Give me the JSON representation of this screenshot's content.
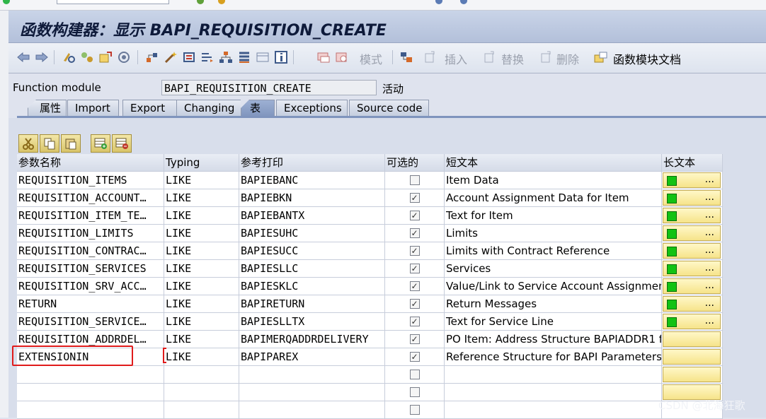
{
  "window": {
    "title": "函数构建器：显示 BAPI_REQUISITION_CREATE"
  },
  "toolbar": {
    "mode_label": "模式",
    "insert_label": "插入",
    "replace_label": "替换",
    "delete_label": "删除",
    "docs_label": "函数模块文档"
  },
  "header": {
    "function_module_label": "Function module",
    "function_module_value": "BAPI_REQUISITION_CREATE",
    "status": "活动"
  },
  "tabs": [
    {
      "label": "属性"
    },
    {
      "label": "Import"
    },
    {
      "label": "Export"
    },
    {
      "label": "Changing"
    },
    {
      "label": "表"
    },
    {
      "label": "Exceptions"
    },
    {
      "label": "Source code"
    }
  ],
  "active_tab": "表",
  "table": {
    "columns": [
      "参数名称",
      "Typing",
      "参考打印",
      "可选的",
      "短文本",
      "长文本"
    ],
    "rows": [
      {
        "name": "REQUISITION_ITEMS",
        "typing": "LIKE",
        "ref": "BAPIEBANC",
        "optional": false,
        "short_text": "Item Data",
        "long_text": true
      },
      {
        "name": "REQUISITION_ACCOUNT…",
        "typing": "LIKE",
        "ref": "BAPIEBKN",
        "optional": true,
        "short_text": "Account Assignment Data for Item",
        "long_text": true
      },
      {
        "name": "REQUISITION_ITEM_TE…",
        "typing": "LIKE",
        "ref": "BAPIEBANTX",
        "optional": true,
        "short_text": "Text for Item",
        "long_text": true
      },
      {
        "name": "REQUISITION_LIMITS",
        "typing": "LIKE",
        "ref": "BAPIESUHC",
        "optional": true,
        "short_text": "Limits",
        "long_text": true
      },
      {
        "name": "REQUISITION_CONTRAC…",
        "typing": "LIKE",
        "ref": "BAPIESUCC",
        "optional": true,
        "short_text": "Limits with Contract Reference",
        "long_text": true
      },
      {
        "name": "REQUISITION_SERVICES",
        "typing": "LIKE",
        "ref": "BAPIESLLC",
        "optional": true,
        "short_text": "Services",
        "long_text": true
      },
      {
        "name": "REQUISITION_SRV_ACC…",
        "typing": "LIKE",
        "ref": "BAPIESKLC",
        "optional": true,
        "short_text": "Value/Link to Service Account Assignment",
        "long_text": true
      },
      {
        "name": "RETURN",
        "typing": "LIKE",
        "ref": "BAPIRETURN",
        "optional": true,
        "short_text": "Return Messages",
        "long_text": true
      },
      {
        "name": "REQUISITION_SERVICE…",
        "typing": "LIKE",
        "ref": "BAPIESLLTX",
        "optional": true,
        "short_text": "Text for Service Line",
        "long_text": true
      },
      {
        "name": "REQUISITION_ADDRDEL…",
        "typing": "LIKE",
        "ref": "BAPIMERQADDRDELIVERY",
        "optional": true,
        "short_text": "PO Item: Address Structure BAPIADDR1 f…",
        "long_text": false
      },
      {
        "name": "EXTENSIONIN",
        "typing": "LIKE",
        "ref": "BAPIPAREX",
        "optional": true,
        "short_text": "Reference Structure for BAPI Parameters …",
        "long_text": false
      },
      {
        "name": "",
        "typing": "",
        "ref": "",
        "optional": false,
        "short_text": "",
        "long_text": false,
        "empty": true
      },
      {
        "name": "",
        "typing": "",
        "ref": "",
        "optional": false,
        "short_text": "",
        "long_text": false,
        "empty": true
      },
      {
        "name": "",
        "typing": "",
        "ref": "",
        "optional": false,
        "short_text": "",
        "long_text": false,
        "empty": true
      }
    ]
  },
  "highlight": {
    "row_name": "EXTENSIONIN",
    "color": "#e01b1b"
  },
  "watermark": "CSDN @北海狂歌",
  "colors": {
    "title_bg": "#b3c0da",
    "active_tab": "#7f94bd",
    "long_text_button": "#f6e48a",
    "status_green": "#13c213"
  }
}
